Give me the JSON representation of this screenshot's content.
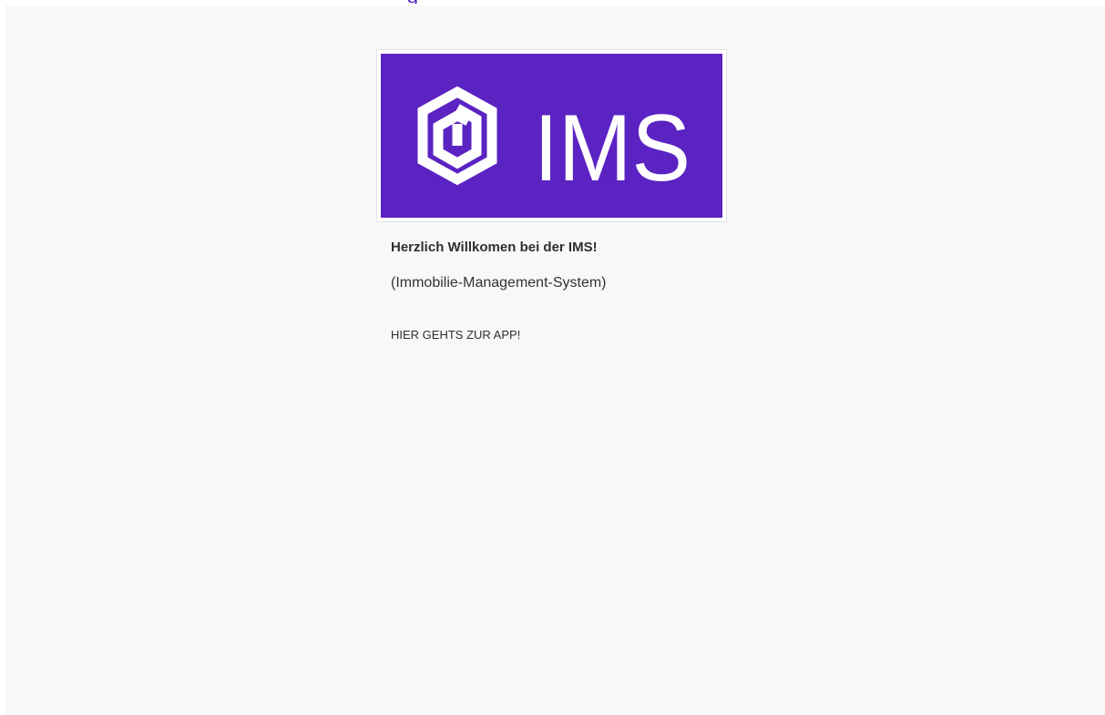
{
  "logo": {
    "text": "IMS",
    "background_color": "#5b23c2",
    "foreground_color": "#ffffff",
    "icon": "hexagon-spiral-icon"
  },
  "welcome": {
    "title": "Herzlich Willkomen bei der IMS!",
    "subtitle": "(Immobilie-Management-System)"
  },
  "link": {
    "label": "HIER GEHTS ZUR APP!"
  },
  "colors": {
    "accent": "#5b23c2",
    "page_background": "#f8f8f9",
    "text": "#2f2f2f"
  }
}
